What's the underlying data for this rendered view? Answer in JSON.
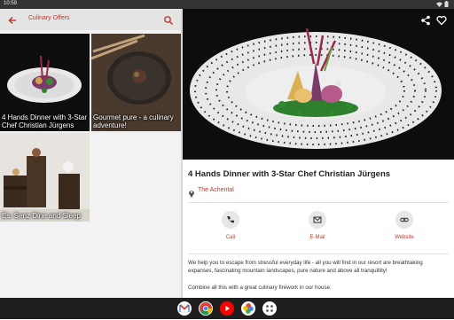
{
  "status_bar": {
    "time": "10:59"
  },
  "list": {
    "title": "Culinary Offers",
    "items": [
      {
        "label": "4 Hands Dinner with 3-Star Chef Christian Jürgens"
      },
      {
        "label": "Gourmet pure - a culinary adventure!"
      },
      {
        "label": "Es: Senz Dine and Sleep"
      }
    ]
  },
  "detail": {
    "title": "4 Hands Dinner with 3-Star Chef Christian Jürgens",
    "location": "The Achental",
    "actions": [
      {
        "label": "Call",
        "icon": "phone-icon"
      },
      {
        "label": "E-Mail",
        "icon": "mail-icon"
      },
      {
        "label": "Website",
        "icon": "link-icon"
      }
    ],
    "description": [
      "We help you to escape from stressful everyday life - all you will find in our resort are breathtaking expanses, fascinating mountain landscapes, pure nature and above all tranquillity!",
      "Combine all this with a great culinary firework in our house."
    ]
  },
  "dock": [
    "gmail-icon",
    "chrome-icon",
    "youtube-icon",
    "photos-icon",
    "app-drawer-icon"
  ],
  "colors": {
    "accent": "#c0392b",
    "app_bar": "#e4e4e4",
    "nav_bar": "#1f1f1f"
  }
}
